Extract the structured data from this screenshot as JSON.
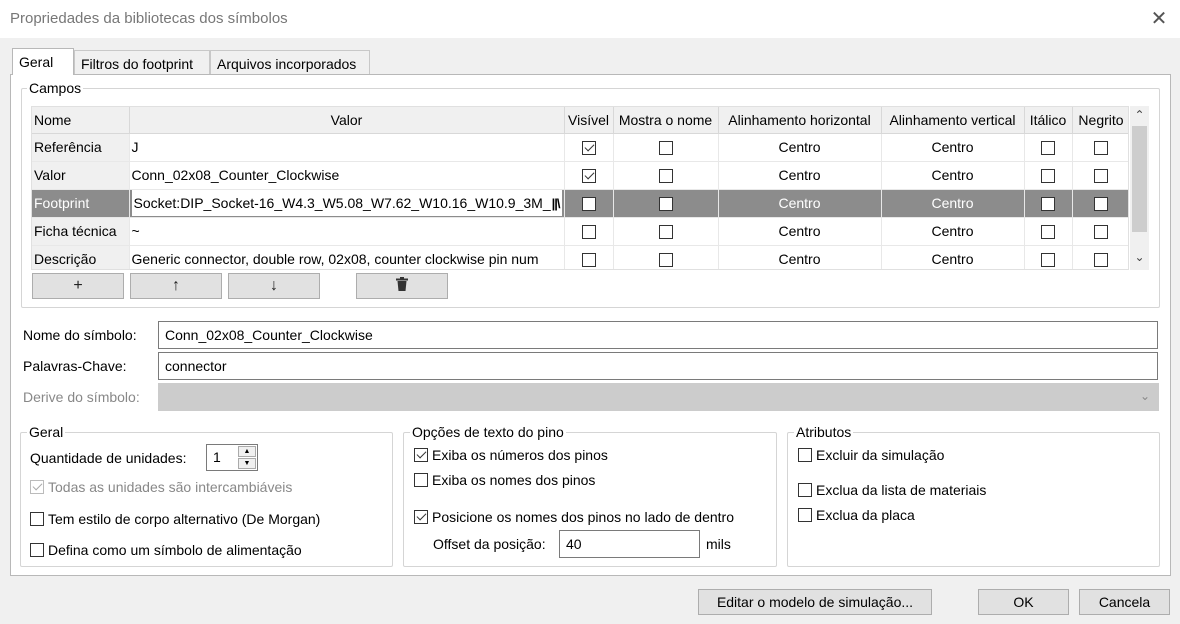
{
  "window": {
    "title": "Propriedades da bibliotecas dos símbolos",
    "close_glyph": "✕"
  },
  "tabs": [
    {
      "label": "Geral",
      "active": true
    },
    {
      "label": "Filtros do footprint",
      "active": false
    },
    {
      "label": "Arquivos incorporados",
      "active": false
    }
  ],
  "fields_group": {
    "label": "Campos",
    "columns": [
      "Nome",
      "Valor",
      "Visível",
      "Mostra o nome",
      "Alinhamento horizontal",
      "Alinhamento vertical",
      "Itálico",
      "Negrito"
    ],
    "rows": [
      {
        "name": "Referência",
        "value": "J",
        "visible": true,
        "show_name": false,
        "h_align": "Centro",
        "v_align": "Centro",
        "italic": false,
        "bold": false
      },
      {
        "name": "Valor",
        "value": "Conn_02x08_Counter_Clockwise",
        "visible": true,
        "show_name": false,
        "h_align": "Centro",
        "v_align": "Centro",
        "italic": false,
        "bold": false
      },
      {
        "name": "Footprint",
        "value": "Socket:DIP_Socket-16_W4.3_W5.08_W7.62_W10.16_W10.9_3M_",
        "visible": false,
        "show_name": false,
        "h_align": "Centro",
        "v_align": "Centro",
        "italic": false,
        "bold": false,
        "selected": true,
        "browse_icon": "library-browse-icon"
      },
      {
        "name": "Ficha técnica",
        "value": "~",
        "visible": false,
        "show_name": false,
        "h_align": "Centro",
        "v_align": "Centro",
        "italic": false,
        "bold": false
      },
      {
        "name": "Descrição",
        "value": "Generic connector, double row, 02x08, counter clockwise pin num",
        "visible": false,
        "show_name": false,
        "h_align": "Centro",
        "v_align": "Centro",
        "italic": false,
        "bold": false
      }
    ],
    "buttons": {
      "add": "+",
      "up": "↑",
      "down": "↓",
      "delete_icon": "trash-icon"
    }
  },
  "symbol": {
    "name_label": "Nome do símbolo:",
    "name_value": "Conn_02x08_Counter_Clockwise",
    "keywords_label": "Palavras-Chave:",
    "keywords_value": "connector",
    "derive_label": "Derive do símbolo:",
    "derive_value": ""
  },
  "general": {
    "label": "Geral",
    "units_label": "Quantidade de unidades:",
    "units_value": "1",
    "interchangeable": {
      "label": "Todas as unidades são intercambiáveis",
      "checked": true,
      "disabled": true
    },
    "demorgan": {
      "label": "Tem estilo de corpo alternativo (De Morgan)",
      "checked": false
    },
    "power": {
      "label": "Defina como um símbolo de alimentação",
      "checked": false
    }
  },
  "pin_text": {
    "label": "Opções de texto do pino",
    "show_numbers": {
      "label": "Exiba os números dos pinos",
      "checked": true
    },
    "show_names": {
      "label": "Exiba os nomes dos pinos",
      "checked": false
    },
    "names_inside": {
      "label": "Posicione os nomes dos pinos no lado de dentro",
      "checked": true
    },
    "offset_label": "Offset da posição:",
    "offset_value": "40",
    "offset_unit": "mils"
  },
  "attributes": {
    "label": "Atributos",
    "exclude_sim": {
      "label": "Excluir da simulação",
      "checked": false
    },
    "exclude_bom": {
      "label": "Exclua da lista de materiais",
      "checked": false
    },
    "exclude_board": {
      "label": "Exclua da placa",
      "checked": false
    }
  },
  "footer": {
    "sim_model": "Editar o modelo de simulação...",
    "ok": "OK",
    "cancel": "Cancela"
  }
}
